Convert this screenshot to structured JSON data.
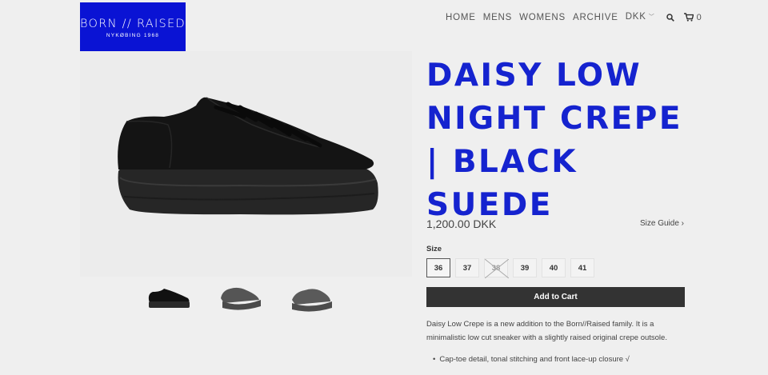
{
  "brand": {
    "name": "BORN // RAISED",
    "sub": "NYKØBING 1968",
    "color": "#0a13d4"
  },
  "nav": {
    "links": [
      "HOME",
      "MENS",
      "WOMENS",
      "ARCHIVE",
      "DKK"
    ],
    "search_icon": "search-icon",
    "cart_icon": "cart-icon",
    "cart_count": "0"
  },
  "product": {
    "title": "DAISY LOW NIGHT CREPE | BLACK SUEDE",
    "title_color": "#1523cf",
    "price": "1,200.00 DKK",
    "size_guide": "Size Guide ›",
    "size_label": "Size",
    "sizes": [
      {
        "label": "36",
        "selected": true,
        "sold_out": false
      },
      {
        "label": "37",
        "selected": false,
        "sold_out": false
      },
      {
        "label": "38",
        "selected": false,
        "sold_out": true
      },
      {
        "label": "39",
        "selected": false,
        "sold_out": false
      },
      {
        "label": "40",
        "selected": false,
        "sold_out": false
      },
      {
        "label": "41",
        "selected": false,
        "sold_out": false
      }
    ],
    "add_to_cart": "Add to Cart",
    "description": "Daisy Low Crepe is a new addition to the Born//Raised family. It is a minimalistic low cut sneaker with a slightly raised original crepe outsole.",
    "bullets": [
      "Cap-toe detail, tonal stitching and front lace-up closure √"
    ]
  }
}
